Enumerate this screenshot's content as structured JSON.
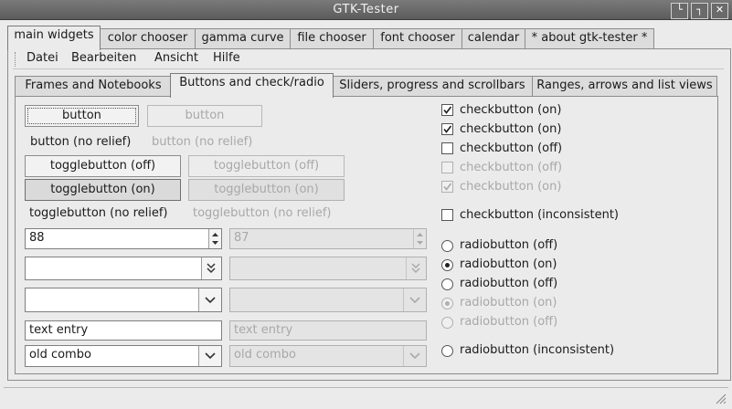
{
  "window": {
    "title": "GTK-Tester",
    "controls": [
      "minimize",
      "maximize",
      "close"
    ]
  },
  "top_tabs": [
    "main widgets",
    "color chooser",
    "gamma curve",
    "file chooser",
    "font chooser",
    "calendar",
    "* about gtk-tester *"
  ],
  "menu": [
    "Datei",
    "Bearbeiten",
    "Ansicht",
    "Hilfe"
  ],
  "sub_tabs": [
    "Frames and Notebooks",
    "Buttons and check/radio",
    "Sliders, progress and scrollbars",
    "Ranges, arrows and list views"
  ],
  "buttons": {
    "button": "button",
    "button_disabled": "button",
    "button_no_relief": "button (no relief)",
    "button_no_relief_disabled": "button (no relief)",
    "toggle_off": "togglebutton (off)",
    "toggle_off_disabled": "togglebutton (off)",
    "toggle_on": "togglebutton (on)",
    "toggle_on_disabled": "togglebutton (on)",
    "toggle_no_relief": "togglebutton (no relief)",
    "toggle_no_relief_disabled": "togglebutton (no relief)"
  },
  "spin": {
    "value": "88",
    "value_disabled": "87"
  },
  "entry": {
    "value": "text entry",
    "value_disabled": "text entry"
  },
  "old_combo": {
    "value": "old combo",
    "value_disabled": "old combo"
  },
  "checkbuttons": [
    {
      "label": "checkbutton (on)",
      "checked": true,
      "disabled": false
    },
    {
      "label": "checkbutton (on)",
      "checked": true,
      "disabled": false
    },
    {
      "label": "checkbutton (off)",
      "checked": false,
      "disabled": false
    },
    {
      "label": "checkbutton (off)",
      "checked": false,
      "disabled": true
    },
    {
      "label": "checkbutton (on)",
      "checked": true,
      "disabled": true
    },
    {
      "label": "checkbutton (inconsistent)",
      "checked": false,
      "disabled": false
    }
  ],
  "radiobuttons": [
    {
      "label": "radiobutton (off)",
      "checked": false,
      "disabled": false
    },
    {
      "label": "radiobutton (on)",
      "checked": true,
      "disabled": false
    },
    {
      "label": "radiobutton (off)",
      "checked": false,
      "disabled": false
    },
    {
      "label": "radiobutton  (on)",
      "checked": true,
      "disabled": true
    },
    {
      "label": "radiobutton (off)",
      "checked": false,
      "disabled": true
    },
    {
      "label": "radiobutton (inconsistent)",
      "checked": false,
      "disabled": false
    }
  ],
  "colors": {
    "titlebar": "#666666",
    "background": "#ebebeb",
    "disabled_text": "#a8a8a8"
  }
}
